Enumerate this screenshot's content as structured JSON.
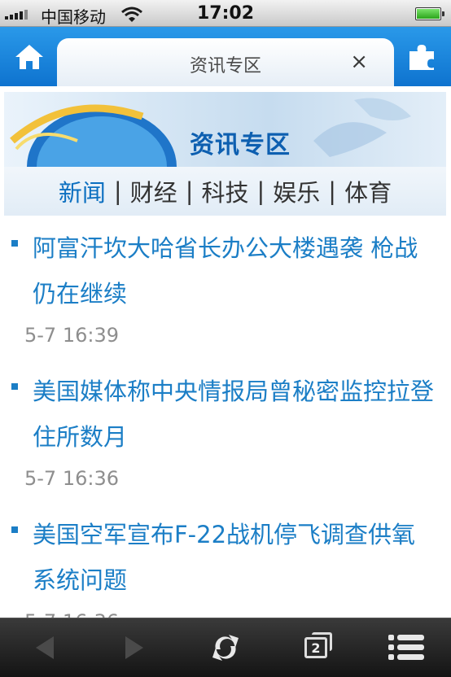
{
  "status": {
    "carrier": "中国移动",
    "time": "17:02"
  },
  "tab": {
    "title": "资讯专区",
    "close": "×"
  },
  "banner": {
    "title": "资讯专区"
  },
  "categories": [
    {
      "label": "新闻",
      "active": true
    },
    {
      "label": "财经",
      "active": false
    },
    {
      "label": "科技",
      "active": false
    },
    {
      "label": "娱乐",
      "active": false
    },
    {
      "label": "体育",
      "active": false
    }
  ],
  "news": [
    {
      "title": "阿富汗坎大哈省长办公大楼遇袭 枪战仍在继续",
      "time": "5-7 16:39"
    },
    {
      "title": "美国媒体称中央情报局曾秘密监控拉登住所数月",
      "time": "5-7 16:36"
    },
    {
      "title": "美国空军宣布F-22战机停飞调查供氧系统问题",
      "time": "5-7 16:36"
    }
  ],
  "toolbar": {
    "tab_count": "2",
    "icons": [
      "back-icon",
      "forward-icon",
      "refresh-icon",
      "tabs-icon",
      "menu-icon"
    ]
  },
  "colors": {
    "accent": "#1b7ec6",
    "tab_bar": "#1a86de",
    "toolbar": "#1e1e1e"
  }
}
